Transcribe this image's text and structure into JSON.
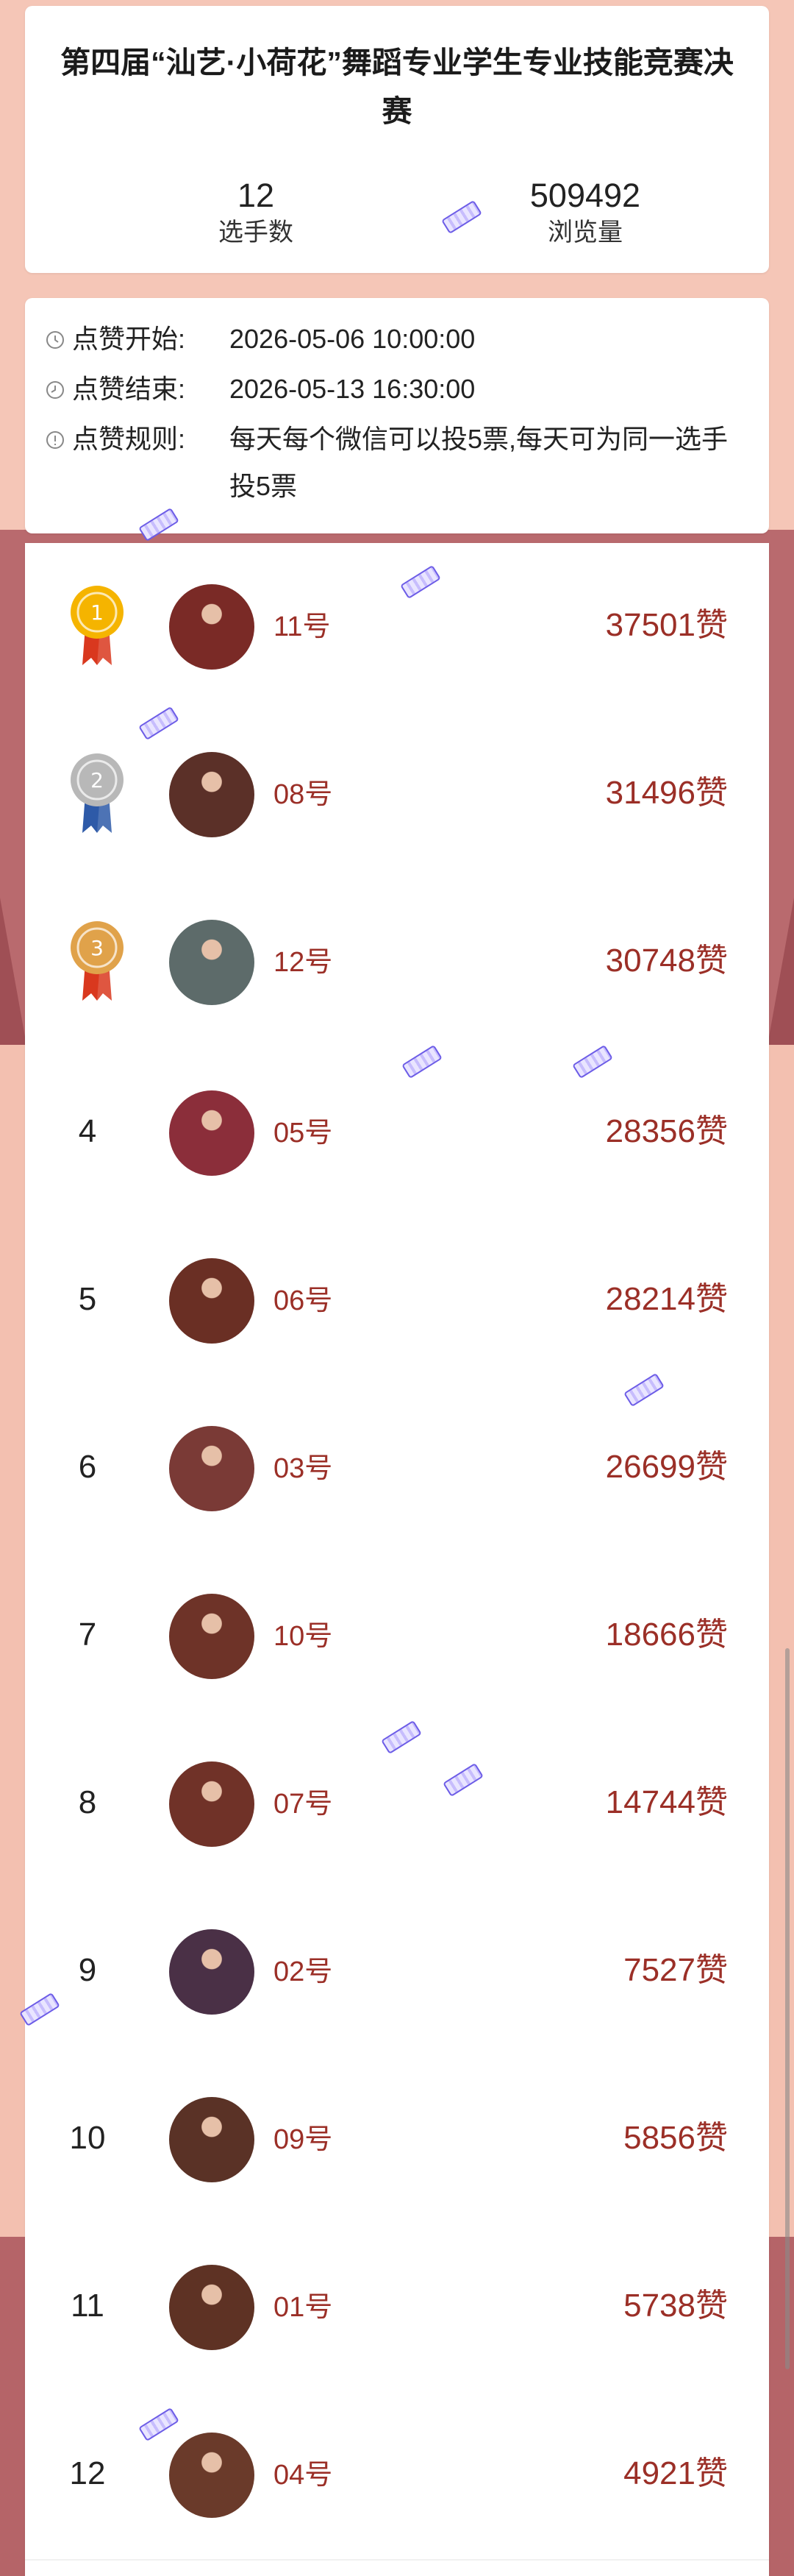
{
  "header": {
    "title": "第四届“汕艺·小荷花”舞蹈专业学生专业技能竞赛决赛",
    "stats": [
      {
        "value": "12",
        "label": "选手数"
      },
      {
        "value": "509492",
        "label": "浏览量"
      }
    ]
  },
  "info": {
    "start_label": "点赞开始:",
    "start_value": "2026-05-06 10:00:00",
    "end_label": "点赞结束:",
    "end_value": "2026-05-13 16:30:00",
    "rule_label": "点赞规则:",
    "rule_value": "每天每个微信可以投5票,每天可为同一选手投5票"
  },
  "ranking": [
    {
      "rank": "1",
      "medal": "gold-medal-icon",
      "name": "11号",
      "votes": "37501赞",
      "avatar_color": "#7a2a26"
    },
    {
      "rank": "2",
      "medal": "silver-medal-icon",
      "name": "08号",
      "votes": "31496赞",
      "avatar_color": "#5b3028"
    },
    {
      "rank": "3",
      "medal": "bronze-medal-icon",
      "name": "12号",
      "votes": "30748赞",
      "avatar_color": "#5d6b6a"
    },
    {
      "rank": "4",
      "name": "05号",
      "votes": "28356赞",
      "avatar_color": "#8b2e3a"
    },
    {
      "rank": "5",
      "name": "06号",
      "votes": "28214赞",
      "avatar_color": "#6a2f24"
    },
    {
      "rank": "6",
      "name": "03号",
      "votes": "26699赞",
      "avatar_color": "#7a3a36"
    },
    {
      "rank": "7",
      "name": "10号",
      "votes": "18666赞",
      "avatar_color": "#6e3328"
    },
    {
      "rank": "8",
      "name": "07号",
      "votes": "14744赞",
      "avatar_color": "#703228"
    },
    {
      "rank": "9",
      "name": "02号",
      "votes": "7527赞",
      "avatar_color": "#4a3046"
    },
    {
      "rank": "10",
      "name": "09号",
      "votes": "5856赞",
      "avatar_color": "#5a3226"
    },
    {
      "rank": "11",
      "name": "01号",
      "votes": "5738赞",
      "avatar_color": "#5e3224"
    },
    {
      "rank": "12",
      "name": "04号",
      "votes": "4921赞",
      "avatar_color": "#6a3a2a"
    }
  ],
  "colors": {
    "accent": "#9b2f27",
    "background": "#f4c4b4",
    "gold": "#f5b400",
    "silver": "#b8b8b8",
    "bronze": "#e0a24a"
  }
}
